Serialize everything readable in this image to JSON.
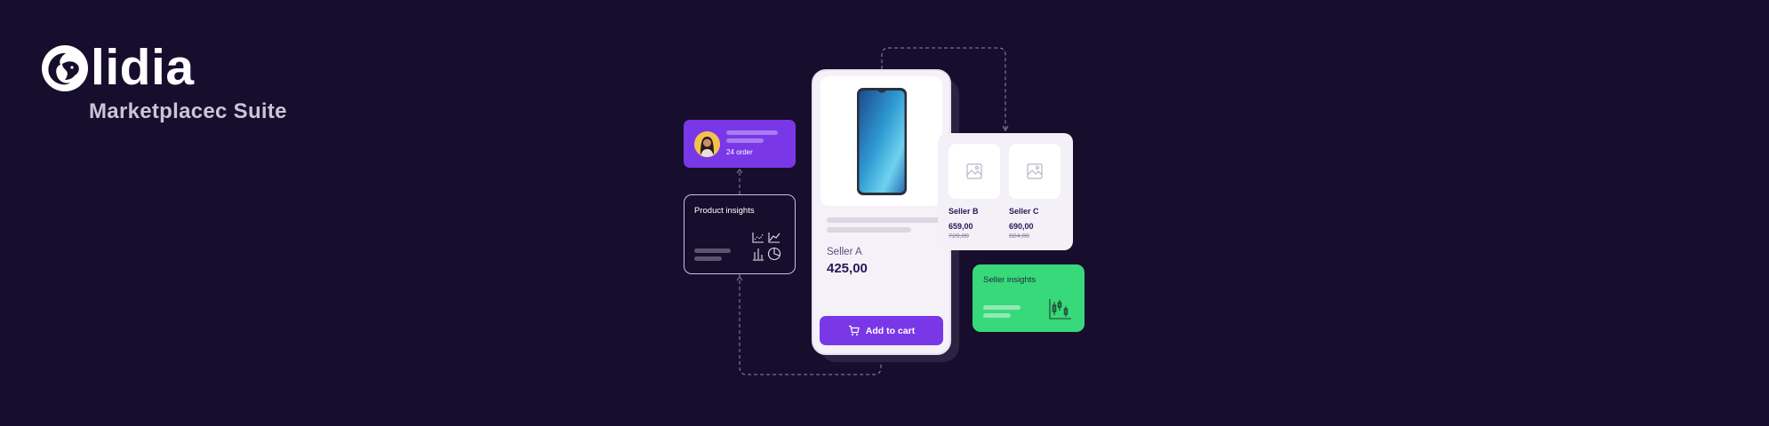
{
  "brand": {
    "name": "lidia",
    "subtitle": "Marketplacec Suite"
  },
  "user_card": {
    "order_count": "24 order"
  },
  "product_insights": {
    "title": "Product insights"
  },
  "product": {
    "seller": "Seller A",
    "price": "425,00",
    "cart_label": "Add to cart"
  },
  "sellers": [
    {
      "name": "Seller B",
      "price": "659,00",
      "old_price": "720,00"
    },
    {
      "name": "Seller C",
      "price": "690,00",
      "old_price": "824,00"
    }
  ],
  "seller_insights": {
    "title": "Seller insights"
  },
  "colors": {
    "background": "#160e2c",
    "accent_purple": "#7a37e8",
    "accent_green": "#38d97a",
    "dark_text": "#2b1657"
  },
  "icons": [
    "lion-logo-icon",
    "cart-icon",
    "image-placeholder-icon",
    "chart-icon"
  ]
}
